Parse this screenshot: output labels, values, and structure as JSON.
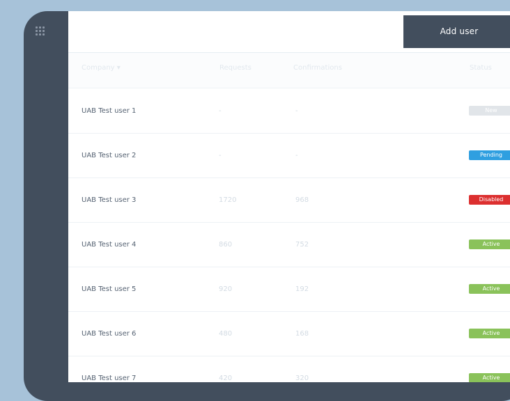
{
  "toolbar": {
    "add_user_label": "Add user"
  },
  "table": {
    "headers": {
      "company": "Company ▾",
      "requests": "Requests",
      "confirmations": "Confirmations",
      "status": "Status"
    },
    "rows": [
      {
        "company": "UAB Test user 1",
        "requests": "-",
        "confirmations": "-",
        "status": "New",
        "status_color": "#e1e5e9"
      },
      {
        "company": "UAB Test user 2",
        "requests": "-",
        "confirmations": "-",
        "status": "Pending",
        "status_color": "#2f9fe0"
      },
      {
        "company": "UAB Test user 3",
        "requests": "1720",
        "confirmations": "968",
        "status": "Disabled",
        "status_color": "#dc2f2f"
      },
      {
        "company": "UAB Test user 4",
        "requests": "860",
        "confirmations": "752",
        "status": "Active",
        "status_color": "#8ac25a"
      },
      {
        "company": "UAB Test user 5",
        "requests": "920",
        "confirmations": "192",
        "status": "Active",
        "status_color": "#8ac25a"
      },
      {
        "company": "UAB Test user 6",
        "requests": "480",
        "confirmations": "168",
        "status": "Active",
        "status_color": "#8ac25a"
      },
      {
        "company": "UAB Test user 7",
        "requests": "420",
        "confirmations": "320",
        "status": "Active",
        "status_color": "#8ac25a"
      }
    ]
  },
  "colors": {
    "sidebar": "#424e5d",
    "background": "#a7c2d9",
    "surface": "#ffffff",
    "primary_text": "#556272",
    "muted_text": "#d3dbe3"
  },
  "icons": {
    "app_menu": "grid-icon"
  }
}
